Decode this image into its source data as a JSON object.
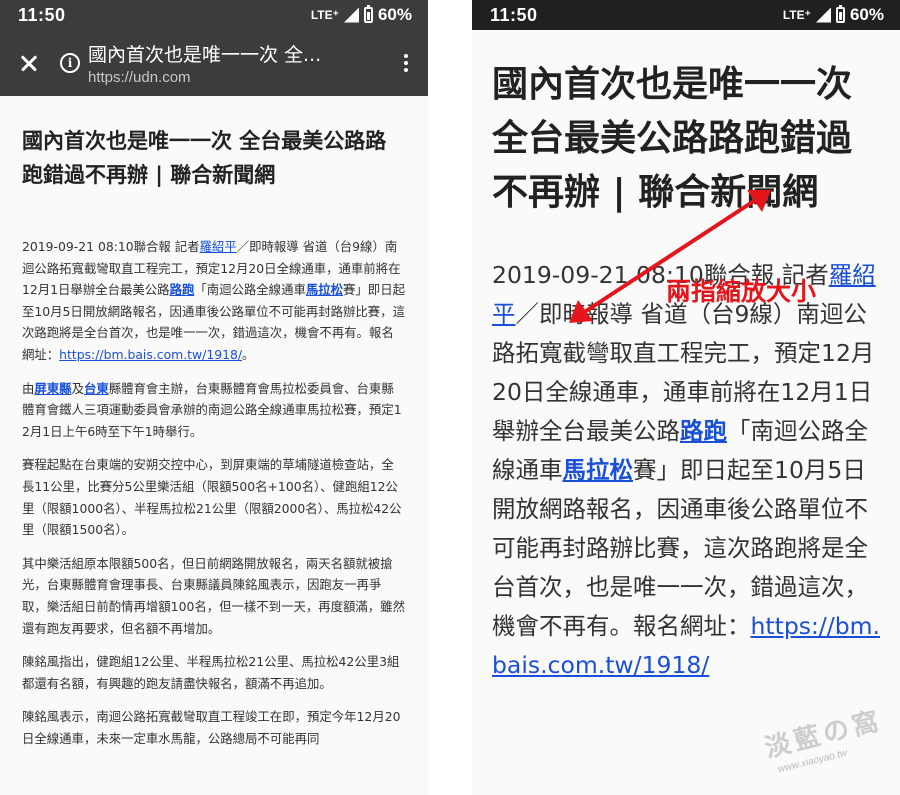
{
  "left": {
    "status": {
      "time": "11:50",
      "network": "LTE⁺",
      "battery": "60%"
    },
    "toolbar": {
      "title": "國內首次也是唯一一次 全...",
      "url": "https://udn.com"
    },
    "article": {
      "headline": "國內首次也是唯一一次 全台最美公路路跑錯過不再辦 | 聯合新聞網",
      "p1": {
        "lead": "2019-09-21 08:10聯合報 記者",
        "reporter": "羅紹平",
        "mid1": "／即時報導 省道（台9線）南迴公路拓寬截彎取直工程完工，預定12月20日全線通車，通車前將在12月1日舉辦全台最美公路",
        "link_run": "路跑",
        "mid2": "「南迴公路全線通車",
        "link_marathon": "馬拉松",
        "mid3": "賽」即日起至10月5日開放網路報名，因通車後公路單位不可能再封路辦比賽，這次路跑將是全台首次，也是唯一一次，錯過這次，機會不再有。報名網址：",
        "url": "https://bm.bais.com.tw/1918/",
        "end": "。"
      },
      "p2": {
        "pre": "由",
        "link_pingtung": "屏東縣",
        "and": "及",
        "link_taitung": "台東",
        "rest": "縣體育會主辦，台東縣體育會馬拉松委員會、台東縣體育會鐵人三項運動委員會承辦的南迴公路全線通車馬拉松賽，預定12月1日上午6時至下午1時舉行。"
      },
      "p3": "賽程起點在台東端的安朔交控中心，到屏東端的草埔隧道檢查站，全長11公里，比賽分5公里樂活組（限額500名+100名）、健跑組12公里（限額1000名）、半程馬拉松21公里（限額2000名）、馬拉松42公里（限額1500名）。",
      "p4": "其中樂活組原本限額500名，但日前網路開放報名，兩天名額就被搶光，台東縣體育會理事長、台東縣議員陳銘風表示，因跑友一再爭取，樂活組日前酌情再增額100名，但一樣不到一天，再度額滿，雖然還有跑友再要求，但名額不再增加。",
      "p5": "陳銘風指出，健跑組12公里、半程馬拉松21公里、馬拉松42公里3組都還有名額，有興趣的跑友請盡快報名，額滿不再追加。",
      "p6": "陳銘風表示，南迴公路拓寬截彎取直工程竣工在即，預定今年12月20日全線通車，未來一定車水馬龍，公路總局不可能再同"
    }
  },
  "right": {
    "status": {
      "time": "11:50",
      "network": "LTE⁺",
      "battery": "60%"
    },
    "article": {
      "headline": "國內首次也是唯一一次 全台最美公路路跑錯過不再辦 | 聯合新聞網",
      "lead": "2019-09-21 08:10聯合報 記者",
      "reporter": "羅紹平",
      "mid1": "／即時報導 省道（台9線）南迴公路拓寬截彎取直工程完工，預定12月20日全線通車，通車前將在12月1日舉辦全台最美公路",
      "link_run": "路跑",
      "mid2": "「南迴公路全線通車",
      "link_marathon": "馬拉松",
      "mid3": "賽」即日起至10月5日開放網路報名，因通車後公路單位不可能再封路辦比賽，這次路跑將是全台首次，也是唯一一次，錯過這次，機會不再有。報名網址：",
      "url": "https://bm.bais.com.tw/1918/"
    }
  },
  "annotation": {
    "label": "兩指縮放大小",
    "color": "#e4151b"
  },
  "watermark": {
    "text": "淡藍の窩",
    "url": "www.xiaoyao.tw"
  }
}
